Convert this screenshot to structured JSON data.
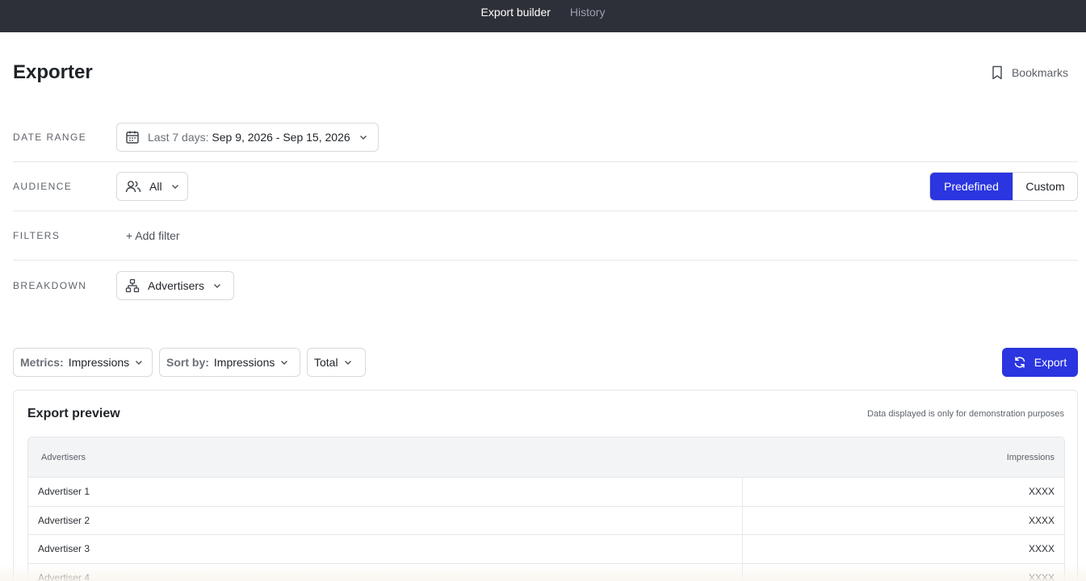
{
  "nav": {
    "tabs": [
      {
        "label": "Export builder",
        "active": true
      },
      {
        "label": "History",
        "active": false
      }
    ]
  },
  "header": {
    "title": "Exporter",
    "bookmarks_label": "Bookmarks"
  },
  "date_range": {
    "label": "DATE RANGE",
    "preset": "Last 7 days:",
    "range": "Sep 9, 2026 - Sep 15, 2026"
  },
  "audience": {
    "label": "AUDIENCE",
    "value": "All",
    "toggle": {
      "predefined": "Predefined",
      "custom": "Custom",
      "selected": "Predefined"
    }
  },
  "filters": {
    "label": "FILTERS",
    "add_label": "+ Add filter"
  },
  "breakdown": {
    "label": "BREAKDOWN",
    "value": "Advertisers"
  },
  "toolbar": {
    "metrics_key": "Metrics:",
    "metrics_value": "Impressions",
    "sort_key": "Sort by:",
    "sort_value": "Impressions",
    "total_label": "Total",
    "export_label": "Export"
  },
  "preview": {
    "title": "Export preview",
    "note": "Data displayed is only for demonstration purposes",
    "columns": [
      "Advertisers",
      "Impressions"
    ],
    "rows": [
      {
        "name": "Advertiser 1",
        "value": "XXXX"
      },
      {
        "name": "Advertiser 2",
        "value": "XXXX"
      },
      {
        "name": "Advertiser 3",
        "value": "XXXX"
      },
      {
        "name": "Advertiser 4",
        "value": "XXXX"
      }
    ]
  },
  "colors": {
    "topbar": "#2d3038",
    "accent": "#2b35e0",
    "border": "#d7d9de"
  }
}
